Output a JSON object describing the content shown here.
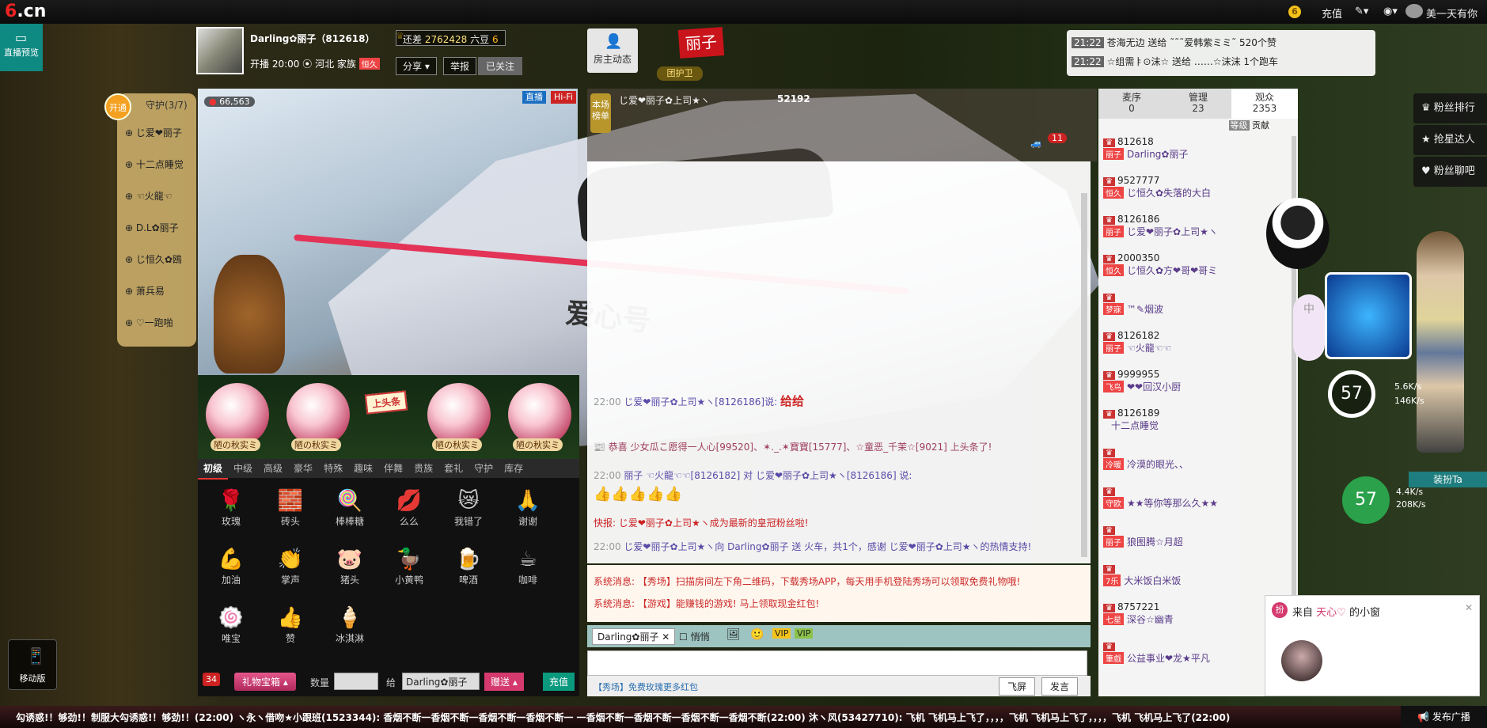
{
  "topbar": {
    "logo": "6.cn",
    "coin": "6",
    "recharge": "充值",
    "username": "美一天有你"
  },
  "left_nav": {
    "live_preview": "直播预览",
    "mobile": "移动版"
  },
  "anchor": {
    "name": "Darling✿丽子（812618）",
    "diff_label": "还差",
    "diff_value": "2762428",
    "diff_unit": "六豆",
    "diff_level": "6",
    "time": "开播 20:00",
    "location": "河北",
    "family_label": "家族",
    "family": "恒久",
    "share": "分享",
    "report": "举报",
    "followed": "已关注",
    "home": "房主动态",
    "title": "丽子",
    "guard": "团护卫"
  },
  "gift_notice": [
    {
      "time": "21:22",
      "text": "苍海无边 送给 ˜˜˜爱韩紫ミミ˜ 520个赞"
    },
    {
      "time": "21:22",
      "text": "☆组需ㅑ⊙沫☆ 送给 ……☆沫沫 1个跑车"
    }
  ],
  "guard_panel": {
    "open": "开通",
    "title": "守护(3/7)",
    "items": [
      "じ爱❤丽子",
      "十二点睡觉",
      "☜火龍☜",
      "D.L✿丽子",
      "じ恒久✿鴎",
      "萧兵易",
      "♡一跑啪"
    ]
  },
  "video": {
    "wealth": "66,563",
    "badge1": "直播",
    "badge2": "Hi-Fi",
    "train_text": "爱心号"
  },
  "gift_shelf": [
    "陋の秋实ミ",
    "陋の秋实ミ",
    "上头条",
    "陋の秋实ミ",
    "陋の秋实ミ"
  ],
  "gift_tabs": [
    "初级",
    "中级",
    "高级",
    "豪华",
    "特殊",
    "趣味",
    "伴舞",
    "贵族",
    "套礼",
    "守护",
    "库存"
  ],
  "gifts": [
    {
      "label": "玫瑰",
      "icon": "🌹"
    },
    {
      "label": "砖头",
      "icon": "🧱"
    },
    {
      "label": "棒棒糖",
      "icon": "🍭"
    },
    {
      "label": "么么",
      "icon": "💋"
    },
    {
      "label": "我错了",
      "icon": "😿"
    },
    {
      "label": "谢谢",
      "icon": "🙏"
    },
    {
      "label": "加油",
      "icon": "💪"
    },
    {
      "label": "掌声",
      "icon": "👏"
    },
    {
      "label": "猪头",
      "icon": "🐷"
    },
    {
      "label": "小黄鸭",
      "icon": "🦆"
    },
    {
      "label": "啤酒",
      "icon": "🍺"
    },
    {
      "label": "咖啡",
      "icon": "☕"
    },
    {
      "label": "唯宝",
      "icon": "🍥"
    },
    {
      "label": "赞",
      "icon": "👍"
    },
    {
      "label": "冰淇淋",
      "icon": "🍦"
    }
  ],
  "gift_bar": {
    "wealth_count": "34",
    "box": "礼物宝箱",
    "qty_label": "数量",
    "to_label": "给",
    "to_value": "Darling✿丽子",
    "give": "赠送",
    "recharge": "充值"
  },
  "chat_top": {
    "fans_rank": "本场榜单",
    "row1": "じ爱❤丽子✿上司★ヽ",
    "score1": "52192",
    "car_count": "11"
  },
  "chat": [
    {
      "time": "22:00",
      "text": "じ爱❤丽子✿上司★ヽ[8126186]说:",
      "tail": "给给"
    },
    {
      "time": "",
      "text": "恭喜 少女瓜こ愿得一人心[99520]、✶._.✶寶寶[15777]、☆童恶_千茉☆[9021] 上头条了!",
      "tail": ""
    },
    {
      "time": "22:00",
      "text": "丽子 ☜火龍☜☜[8126182] 对 じ爱❤丽子✿上司★ヽ[8126186] 说:",
      "tail": ""
    },
    {
      "time": "",
      "text": "快报: じ爱❤丽子✿上司★ヽ成为最新的皇冠粉丝啦!",
      "tail": ""
    },
    {
      "time": "22:00",
      "text": "じ爱❤丽子✿上司★ヽ向 Darling✿丽子 送 火车，共1个，感谢 じ爱❤丽子✿上司★ヽ的热情支持!",
      "tail": ""
    }
  ],
  "system": [
    "系统消息: 【秀场】扫描房间左下角二维码，下载秀场APP，每天用手机登陆秀场可以领取免费礼物哦!",
    "系统消息: 【游戏】能赚钱的游戏! 马上领取现金红包!"
  ],
  "input_bar": {
    "target": "Darling✿丽子",
    "quiet": "悄悄",
    "promo": "【秀场】免费玫瑰更多红包",
    "fly": "飞屏",
    "send": "发言"
  },
  "right_tabs": [
    {
      "label": "麦序",
      "count": "0"
    },
    {
      "label": "管理",
      "count": "23"
    },
    {
      "label": "观众",
      "count": "2353"
    }
  ],
  "right_sub": {
    "sort1": "等级",
    "sort2": "贡献"
  },
  "users": [
    {
      "id": "812618",
      "name": "Darling✿丽子",
      "badge": "丽子"
    },
    {
      "id": "9527777",
      "name": "じ恒久✿失落的大白",
      "badge": "恒久"
    },
    {
      "id": "8126186",
      "name": "じ爱❤丽子✿上司★ヽ",
      "badge": "丽子"
    },
    {
      "id": "2000350",
      "name": "じ恒久✿方❤哥❤哥ミ",
      "badge": "恒久"
    },
    {
      "id": "",
      "name": "™✎烟波",
      "badge": "梦寐"
    },
    {
      "id": "8126182",
      "name": "☜火龍☜☜",
      "badge": "丽子"
    },
    {
      "id": "9999955",
      "name": "❤❤回汉小厨",
      "badge": "飞鸟"
    },
    {
      "id": "8126189",
      "name": "十二点睡觉",
      "badge": ""
    },
    {
      "id": "",
      "name": "冷漠的眼光、、",
      "badge": "冷暖"
    },
    {
      "id": "",
      "name": "★★等你等那么久★★",
      "badge": "守欧"
    },
    {
      "id": "",
      "name": "狼图腾☆月超",
      "badge": "丽子"
    },
    {
      "id": "",
      "name": "大米饭白米饭",
      "badge": "7乐"
    },
    {
      "id": "8757221",
      "name": "深谷☆幽青",
      "badge": "七星"
    },
    {
      "id": "",
      "name": "公益事业❤龙★平凡",
      "badge": "筆戲"
    }
  ],
  "right_panel": {
    "fans_rank": "粉丝排行",
    "grab": "抢星达人",
    "fans_chat": "粉丝聊吧",
    "gauge1": "57",
    "up1": "5.6K/s",
    "down1": "146K/s",
    "gauge2": "57",
    "up2": "4.4K/s",
    "down2": "208K/s",
    "dress": "装扮Ta"
  },
  "popup": {
    "from_label": "来自",
    "from_name": "天心♡",
    "suffix": "的小窗"
  },
  "ticker": {
    "text": "勾诱惑!！够劲!！制服大勾诱惑!！够劲!！(22:00)   ヽ永ヽ借吻★小跟班(1523344): 香烟不断一香烟不断一香烟不断一香烟不断一   一香烟不断一香烟不断一香烟不断一香烟不断(22:00)   沐ヽ风(53427710): 飞机 飞机马上飞了，，，，飞机 飞机马上飞了，，，，飞机 飞机马上飞了(22:00)",
    "publish": "发布广播"
  },
  "colors": {
    "accent": "#e33458",
    "teal": "#0e8a82"
  }
}
